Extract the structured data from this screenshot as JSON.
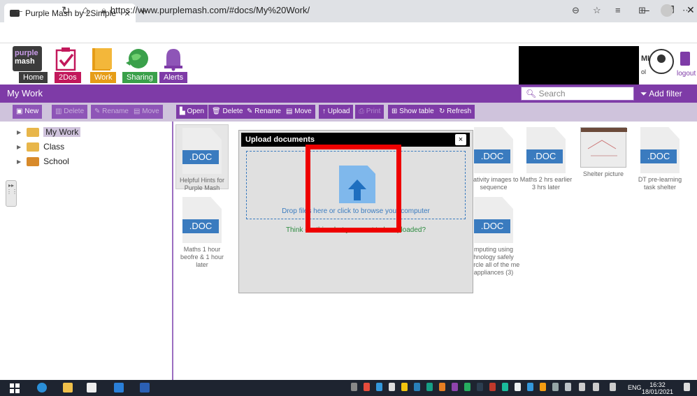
{
  "browser": {
    "tab_title": "Purple Mash by 2Simple",
    "tab_close": "×",
    "new_tab": "+",
    "url": "https://www.purplemash.com/#docs/My%20Work/"
  },
  "app": {
    "logo_line1": "purple",
    "logo_line2": "mash",
    "nav": [
      "Home",
      "2Dos",
      "Work",
      "Sharing",
      "Alerts"
    ],
    "nav_colors": [
      "#3c3c3c",
      "#c2185b",
      "#e69d17",
      "#3aa04a",
      "#7e3ba7"
    ],
    "account_initials": "MI",
    "account_sub": "ol",
    "logout_label": "logout"
  },
  "titlebar": {
    "title": "My Work",
    "search_placeholder": "Search",
    "add_filter": "Add filter"
  },
  "toolbar_left": [
    {
      "label": "New",
      "enabled": true
    },
    {
      "label": "Delete",
      "enabled": false
    },
    {
      "label": "Rename",
      "enabled": false
    },
    {
      "label": "Move",
      "enabled": false
    }
  ],
  "toolbar_right": [
    {
      "label": "Open",
      "enabled": true
    },
    {
      "label": "Delete",
      "enabled": true
    },
    {
      "label": "Rename",
      "enabled": true
    },
    {
      "label": "Move",
      "enabled": true
    },
    {
      "label": "Upload",
      "enabled": true
    },
    {
      "label": "Print",
      "enabled": false
    },
    {
      "label": "Show table",
      "enabled": true
    },
    {
      "label": "Refresh",
      "enabled": true
    }
  ],
  "tree": [
    {
      "label": "My Work",
      "selected": true
    },
    {
      "label": "Class",
      "selected": false
    },
    {
      "label": "School",
      "selected": false
    }
  ],
  "files": [
    {
      "name": "Helpful Hints for Purple Mash",
      "type": "DOC"
    },
    {
      "name": "Nativity images to sequence",
      "type": "DOC"
    },
    {
      "name": "Maths 2 hrs earlier 3 hrs later",
      "type": "DOC"
    },
    {
      "name": "Shelter picture",
      "type": "image"
    },
    {
      "name": "DT pre-learning task shelter",
      "type": "DOC"
    },
    {
      "name": "Maths 1 hour beofre & 1 hour later",
      "type": "DOC"
    },
    {
      "name": "mputing using hnology safely Circle all of the me appliances (3)",
      "type": "DOC"
    }
  ],
  "doc_label": ".DOC",
  "modal": {
    "title": "Upload documents",
    "close": "×",
    "drop_text": "Drop files here or click to browse your computer",
    "think_text": "Think - is this what you want to be uploaded?"
  },
  "taskbar": {
    "lang": "ENG",
    "time": "16:32",
    "date": "18/01/2021"
  }
}
